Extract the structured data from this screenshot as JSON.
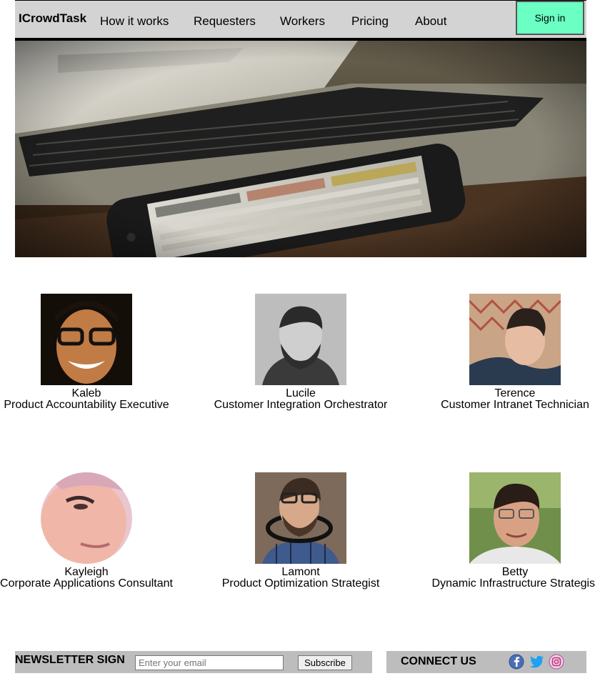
{
  "header": {
    "logo": "ICrowdTask",
    "nav": [
      "How it works",
      "Requesters",
      "Workers",
      "Pricing",
      "About"
    ],
    "signin_label": "Sign in",
    "signin_color": "#6bffc4"
  },
  "hero": {
    "image": "laptop-and-smartphone-photo"
  },
  "team": [
    {
      "name": "Kaleb",
      "role": "Product Accountability Executive"
    },
    {
      "name": "Lucile",
      "role": "Customer Integration Orchestrator"
    },
    {
      "name": "Terence",
      "role": "Customer Intranet Technician"
    },
    {
      "name": "Kayleigh",
      "role": "Corporate Applications Consultant"
    },
    {
      "name": "Lamont",
      "role": "Product Optimization Strategist"
    },
    {
      "name": "Betty",
      "role": "Dynamic Infrastructure Strategist"
    }
  ],
  "newsletter": {
    "title": "NEWSLETTER SIGN",
    "placeholder": "Enter your email",
    "subscribe_label": "Subscribe"
  },
  "connect": {
    "title": "CONNECT US",
    "icons": [
      "facebook-icon",
      "twitter-icon",
      "instagram-icon"
    ]
  }
}
